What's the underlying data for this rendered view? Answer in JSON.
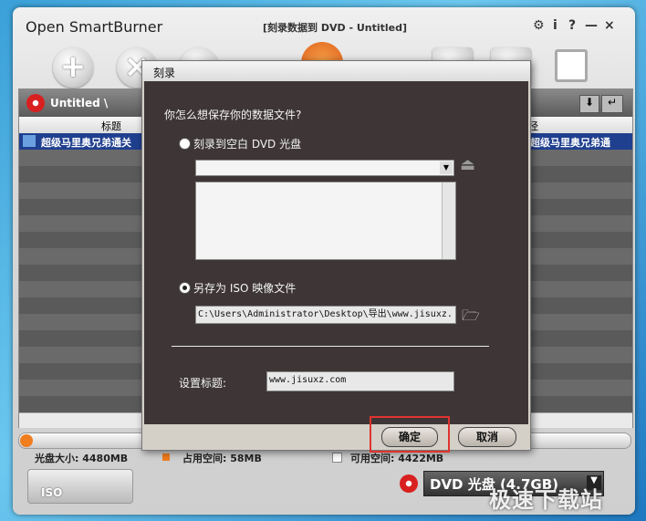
{
  "window": {
    "app_title": "Open SmartBurner",
    "doc_title": "[刻录数据到 DVD - Untitled]",
    "buttons": [
      "⚙",
      "i",
      "?",
      "—",
      "×"
    ]
  },
  "toolbar": {
    "icons": [
      "add-icon",
      "remove-icon",
      "disc-icon",
      "burn-icon",
      "folder-icon",
      "save-icon"
    ]
  },
  "panel": {
    "project": "Untitled \\",
    "col_title": "标题",
    "col_path": "径",
    "file_name": "超级马里奥兄弟通关",
    "file_path": "超级马里奥兄弟通"
  },
  "status": {
    "disc_size": "光盘大小: 4480MB",
    "used": "占用空间: 58MB",
    "free": "可用空间: 4422MB"
  },
  "bottom": {
    "iso_label": "ISO",
    "disc_type": "DVD 光盘 (4.7GB)"
  },
  "dialog": {
    "title": "刻录",
    "question": "你怎么想保存你的数据文件?",
    "opt_disc": "刻录到空白 DVD 光盘",
    "opt_iso": "另存为 ISO 映像文件",
    "iso_path": "C:\\Users\\Administrator\\Desktop\\导出\\www.jisuxz.",
    "label_title": "设置标题:",
    "title_value": "www.jisuxz.com",
    "ok": "确定",
    "cancel": "取消"
  },
  "watermark": "极速下载站"
}
